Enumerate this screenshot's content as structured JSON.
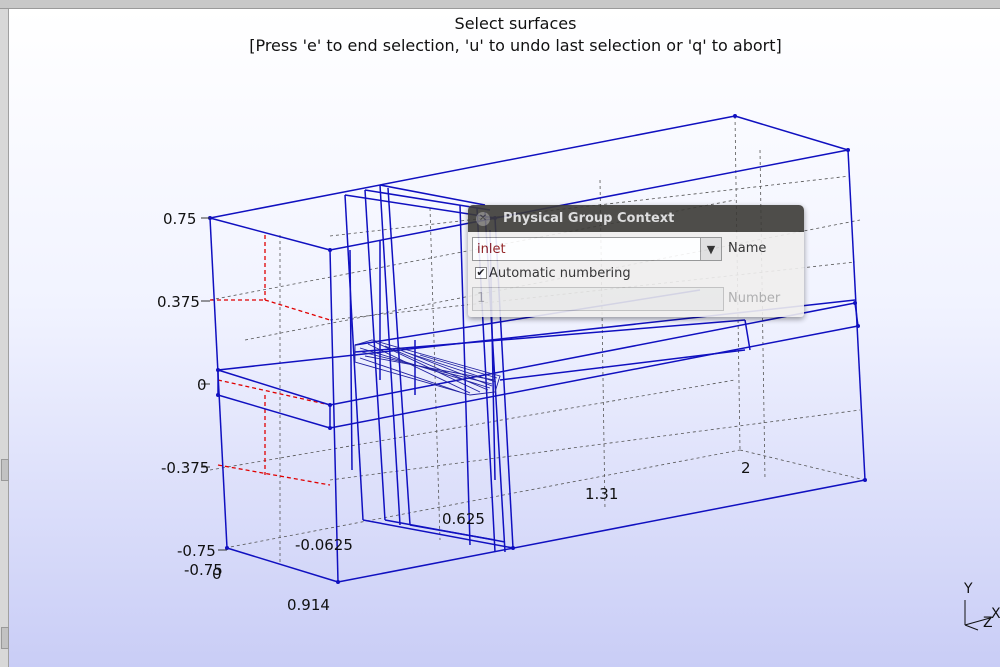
{
  "prompt": {
    "title": "Select surfaces",
    "help": "[Press 'e' to end selection, 'u' to undo last selection or 'q' to abort]"
  },
  "axis_labels": {
    "y_ticks": [
      "0.75",
      "0.375",
      "0",
      "-0.375",
      "-0.75"
    ],
    "z_ticks": [
      "-0.75",
      "0"
    ],
    "x_ticks": [
      "-0.0625",
      "0.625",
      "1.31",
      "2"
    ],
    "origin_label": "0.914"
  },
  "triad": {
    "y": "Y",
    "z": "Z",
    "x": "X"
  },
  "dialog": {
    "title": "Physical Group Context",
    "name_value": "inlet",
    "name_label": "Name",
    "auto_numbering_label": "Automatic numbering",
    "auto_numbering_checked": true,
    "number_value": "1",
    "number_label": "Number"
  },
  "colors": {
    "edges": "#1010c0",
    "grid": "#555555",
    "highlight": "#e00000",
    "dialog_title_bg": "#3c3b37",
    "name_text": "#8a1010"
  },
  "icons": {
    "close": "close-icon",
    "dropdown": "chevron-down-icon",
    "check": "checkmark-icon"
  }
}
